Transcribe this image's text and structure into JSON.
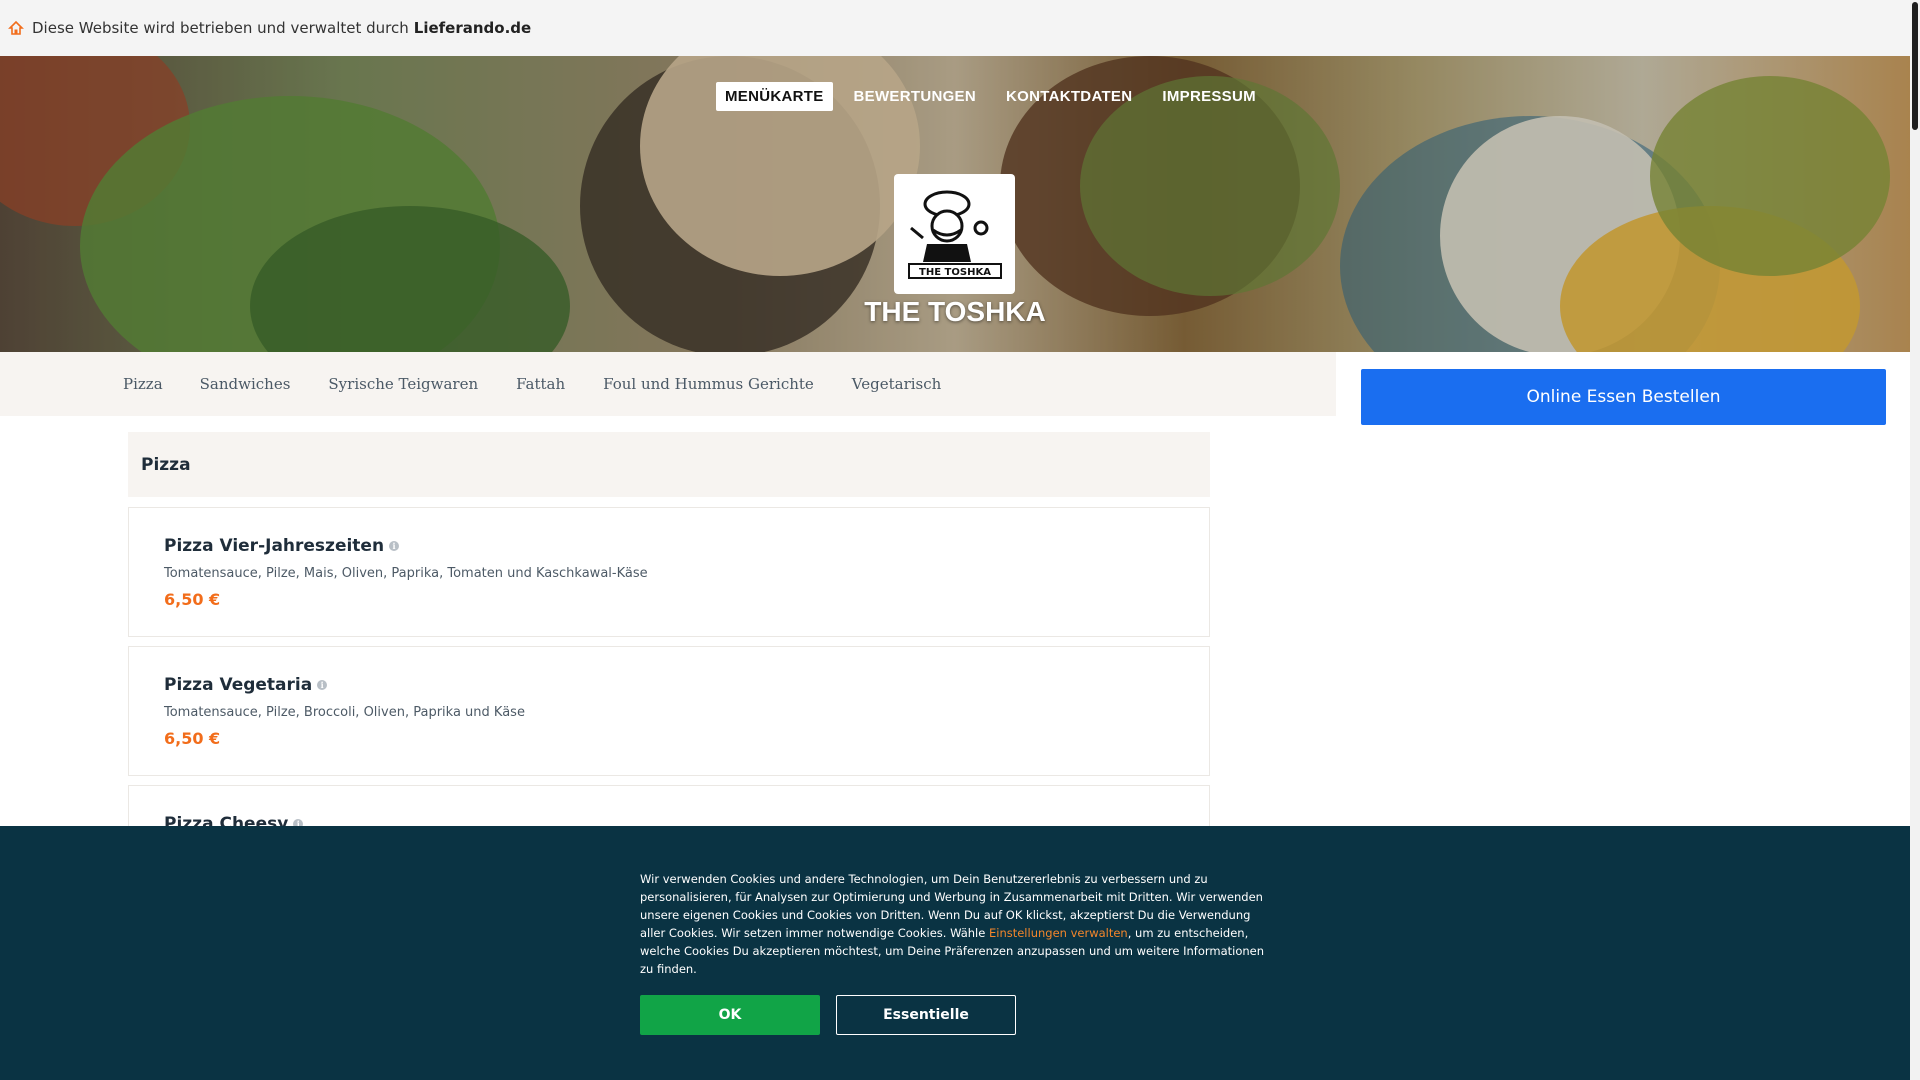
{
  "notice": {
    "text": "Diese Website wird betrieben und verwaltet durch",
    "brand": "Lieferando.de"
  },
  "topnav": [
    "MENÜKARTE",
    "BEWERTUNGEN",
    "KONTAKTDATEN",
    "IMPRESSUM"
  ],
  "restaurant": {
    "name": "THE TOSHKA",
    "logo_text": "THE TOSHKA"
  },
  "categories": [
    "Pizza",
    "Sandwiches",
    "Syrische Teigwaren",
    "Fattah",
    "Foul und Hummus Gerichte",
    "Vegetarisch"
  ],
  "order_button": "Online Essen Bestellen",
  "menu": {
    "section_title": "Pizza",
    "items": [
      {
        "name": "Pizza Vier-Jahreszeiten",
        "desc": "Tomatensauce, Pilze, Mais, Oliven, Paprika, Tomaten und Kaschkawal-Käse",
        "price": "6,50 €"
      },
      {
        "name": "Pizza Vegetaria",
        "desc": "Tomatensauce, Pilze, Broccoli, Oliven, Paprika und Käse",
        "price": "6,50 €"
      },
      {
        "name": "Pizza Cheesy",
        "desc": "",
        "price": ""
      }
    ]
  },
  "cookie": {
    "text_before": "Wir verwenden Cookies und andere Technologien, um Dein Benutzererlebnis zu verbessern und zu personalisieren, für Analysen zur Optimierung und Werbung in Zusammenarbeit mit Dritten. Wir verwenden unsere eigenen Cookies und Cookies von Dritten. Wenn Du auf OK klickst, akzeptierst Du die Verwendung aller Cookies. Wir setzen immer notwendige Cookies. Wähle",
    "link": "Einstellungen verwalten",
    "text_after": ", um zu entscheiden, welche Cookies Du akzeptieren möchtest, um Deine Präferenzen anzupassen und um weitere Informationen zu finden.",
    "ok_label": "OK",
    "essential_label": "Essentielle"
  },
  "colors": {
    "accent_blue": "#1a6ef0",
    "price_orange": "#f26d1b",
    "cookie_bg": "#0a3343",
    "ok_green": "#11a447"
  }
}
